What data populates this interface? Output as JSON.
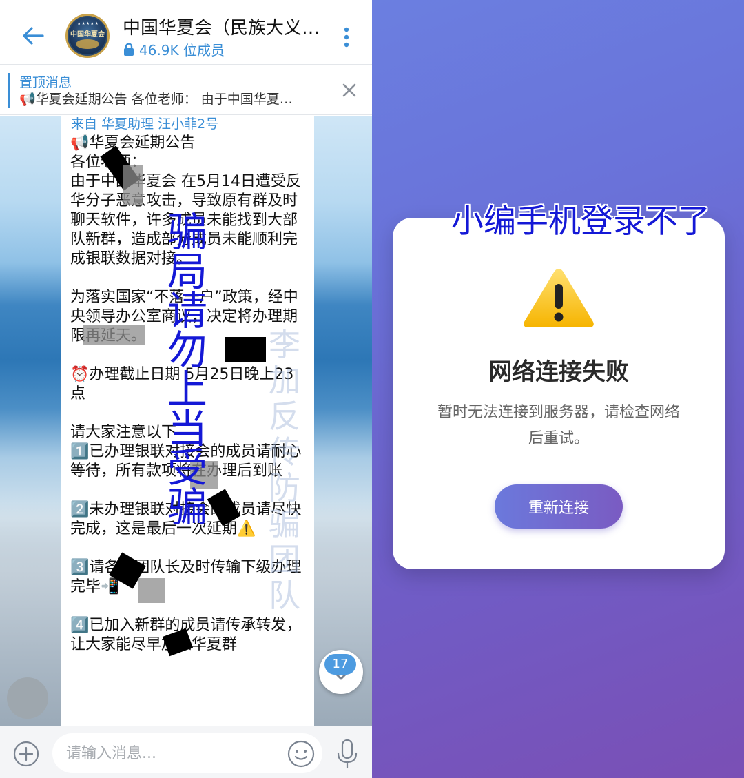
{
  "left_panel": {
    "header": {
      "title": "中国华夏会（民族大义…",
      "member_count": "46.9K 位成员",
      "avatar_text": "中国华夏会"
    },
    "pinned": {
      "label": "置顶消息",
      "text": "📢华夏会延期公告 各位老师： 由于中国华夏…"
    },
    "message": {
      "sender": "来自 华夏助理 汪小菲2号",
      "body": "📢华夏会延期公告\n各位老师：\n由于中国华夏会 在5月14日遭受反华分子恶意攻击，导致原有群及时聊天软件，许多成员未能找到大部队新群，造成部分成员未能顺利完成银联数据对接。\n\n为落实国家“不落一户”政策，经中央领导办公室商议，决定将办理期限再延天。\n\n⏰办理截止日期 5月25日晚上23点\n\n请大家注意以下\n1️⃣已办理银联对接会的成员请耐心等待，所有款项将在办理后到账\n\n2️⃣未办理银联对接会的成员请尽快完成，这是最后一次延期⚠️\n\n3️⃣请各位团队长及时传输下级办理完毕📲\n\n4️⃣已加入新群的成员请传承转发，让大家能尽早加入华夏群"
    },
    "overlay_text": "骗\n局\n请\n勿\n上\n当\n受\n骗",
    "watermark": "李\n加\n反\n传\n防\n骗\n团\n队",
    "unread_count": "17",
    "input": {
      "placeholder": "请输入消息..."
    }
  },
  "right_panel": {
    "annotation": "小编手机登录不了",
    "dialog": {
      "title": "网络连接失败",
      "message": "暂时无法连接到服务器，请检查网络后重试。",
      "button": "重新连接"
    }
  },
  "colors": {
    "accent_blue": "#3a8ed6",
    "overlay_blue": "#1418d6",
    "right_bg_start": "#6b7fe0",
    "right_bg_end": "#7a4fb5"
  },
  "icons": [
    "back-arrow-icon",
    "lock-icon",
    "more-vertical-icon",
    "close-icon",
    "chevron-down-icon",
    "plus-icon",
    "emoji-icon",
    "microphone-icon",
    "warning-icon"
  ]
}
